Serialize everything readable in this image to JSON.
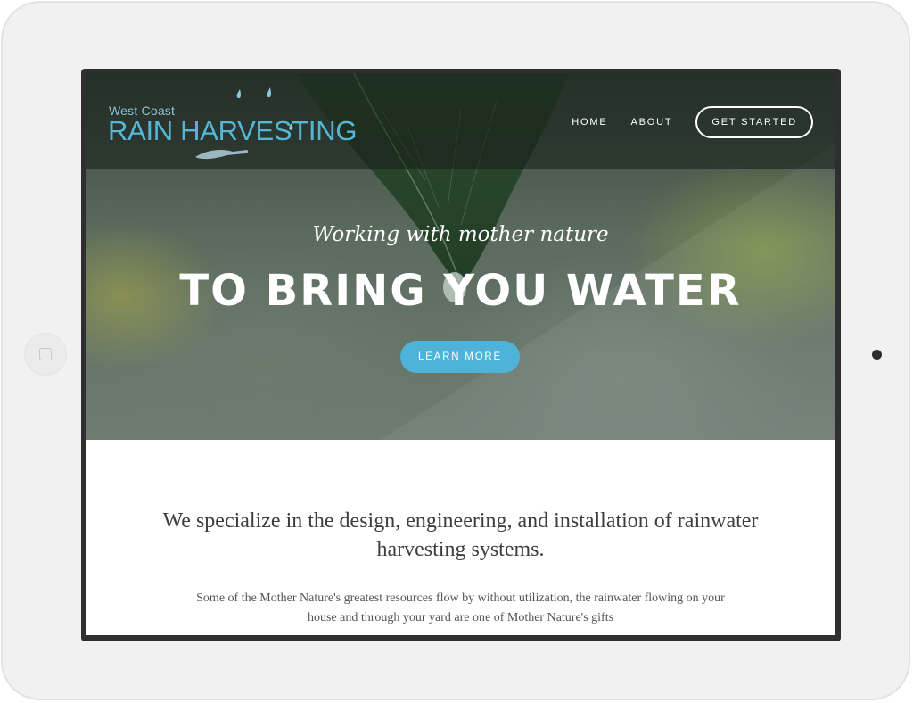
{
  "site": {
    "logo": {
      "small_text": "West Coast",
      "big_text": "RAIN HARVESTING"
    },
    "nav": {
      "home": "HOME",
      "about": "ABOUT",
      "cta": "GET STARTED"
    },
    "hero": {
      "tagline": "Working with mother nature",
      "headline": "TO BRING YOU WATER",
      "button": "LEARN MORE"
    },
    "intro": {
      "lead": "We specialize in the design, engineering, and installation of rainwater harvesting systems.",
      "body": "Some of the Mother Nature's greatest resources flow by without utilization, the rainwater flowing on your house and through your yard are one of Mother Nature's gifts"
    }
  },
  "colors": {
    "accent": "#4fb3d9",
    "logo_blue": "#55b6d8",
    "device_frame": "#f1f1f1"
  },
  "icons": {
    "logo_mark": "raindrops-hand-icon",
    "home_button": "home-button-icon",
    "camera": "camera-icon"
  }
}
